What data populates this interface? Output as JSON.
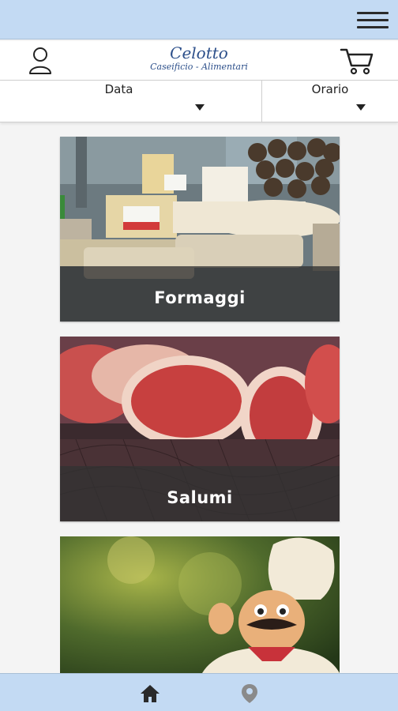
{
  "header": {
    "brand_name": "Celotto",
    "brand_subtitle": "Caseificio - Alimentari"
  },
  "filters": {
    "date_label": "Data",
    "time_label": "Orario"
  },
  "categories": [
    {
      "label": "Formaggi",
      "image": "cheese-photo"
    },
    {
      "label": "Salumi",
      "image": "cured-meat-photo"
    },
    {
      "label": "",
      "image": "chef-figurine-photo"
    }
  ],
  "icons": {
    "menu": "hamburger-menu-icon",
    "account": "user-icon",
    "cart": "shopping-cart-icon",
    "home": "home-icon",
    "location": "map-pin-icon"
  },
  "colors": {
    "bars": "#c3daf3",
    "brand": "#2c4f8a",
    "home_icon": "#2a2a2a",
    "location_icon": "#8a8a8a"
  }
}
